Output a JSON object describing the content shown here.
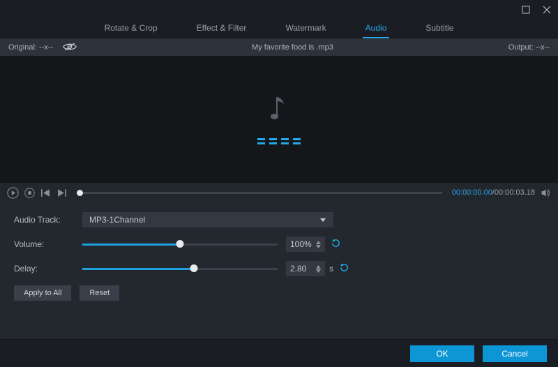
{
  "window": {
    "maximize": "□",
    "close": "×"
  },
  "tabs": {
    "rotate": "Rotate & Crop",
    "effect": "Effect & Filter",
    "watermark": "Watermark",
    "audio": "Audio",
    "subtitle": "Subtitle"
  },
  "infobar": {
    "original": "Original: --x--",
    "filename": "My favorite food is .mp3",
    "output": "Output: --x--"
  },
  "player": {
    "cur_time": "00:00:00.00",
    "total_time": "/00:00:03.18"
  },
  "settings": {
    "audio_track_label": "Audio Track:",
    "audio_track_value": "MP3-1Channel",
    "volume_label": "Volume:",
    "volume_value": "100%",
    "volume_pct": 50,
    "delay_label": "Delay:",
    "delay_value": "2.80",
    "delay_unit": "s",
    "delay_pct": 57,
    "apply_all": "Apply to All",
    "reset": "Reset"
  },
  "footer": {
    "ok": "OK",
    "cancel": "Cancel"
  }
}
